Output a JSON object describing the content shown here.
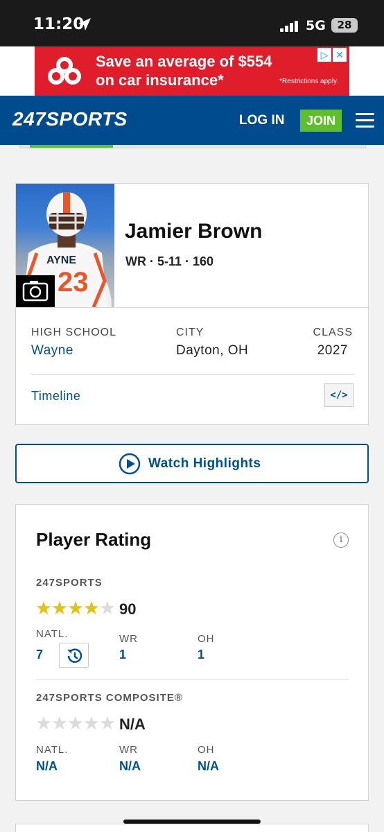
{
  "status_bar": {
    "time": "11:20",
    "network": "5G",
    "battery": "28"
  },
  "ad": {
    "line1": "Save an average of $554",
    "line2": "on car insurance*",
    "fine_print": "*Restrictions apply.",
    "info_glyph": "▷",
    "close_glyph": "✕"
  },
  "nav": {
    "logo": "247SPORTS",
    "login": "LOG IN",
    "join": "JOIN"
  },
  "progress": {
    "fraction": 0.24
  },
  "player": {
    "name": "Jamier Brown",
    "info": "WR · 5-11 · 160",
    "jersey_text": "AYNE",
    "jersey_number": "23"
  },
  "fields": {
    "high_school_label": "HIGH SCHOOL",
    "high_school": "Wayne",
    "city_label": "CITY",
    "city": "Dayton, OH",
    "class_label": "CLASS",
    "class": "2027"
  },
  "timeline": {
    "label": "Timeline",
    "embed_glyph": "</>"
  },
  "highlights": {
    "label": "Watch Highlights"
  },
  "rating": {
    "title": "Player Rating",
    "info_glyph": "i",
    "sports247": {
      "label": "247SPORTS",
      "stars": 4,
      "score": "90",
      "natl_label": "NATL.",
      "natl": "7",
      "pos_label": "WR",
      "pos": "1",
      "state_label": "OH",
      "state": "1"
    },
    "composite": {
      "label": "247SPORTS COMPOSITE®",
      "stars": 0,
      "score": "N/A",
      "natl_label": "NATL.",
      "natl": "N/A",
      "pos_label": "WR",
      "pos": "N/A",
      "state_label": "OH",
      "state": "N/A"
    }
  },
  "colors": {
    "brand_blue": "#004b8d",
    "link_blue": "#00508c",
    "join_green": "#5fbe2e",
    "ad_red": "#e01e2b",
    "star_gold": "#e3c11b",
    "star_empty": "#dcdcdc"
  }
}
